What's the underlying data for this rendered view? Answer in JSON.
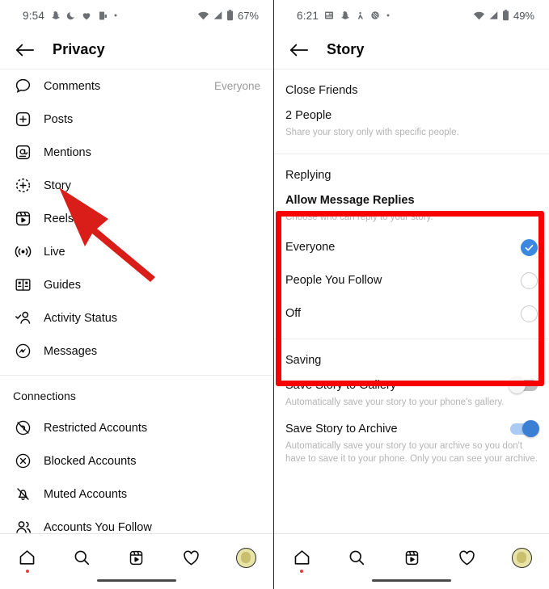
{
  "left": {
    "statusbar": {
      "time": "9:54",
      "icons": [
        "snapchat-icon",
        "moon-icon",
        "heart-icon",
        "phone-link-icon",
        "dot-icon"
      ],
      "wifi": "wifi-icon",
      "signal": "signal-icon",
      "battery_icon": "battery-icon",
      "battery": "67%"
    },
    "appbar": {
      "back": "back-arrow-icon",
      "title": "Privacy"
    },
    "items": [
      {
        "icon": "comment-bubble-icon",
        "label": "Comments",
        "value": "Everyone"
      },
      {
        "icon": "plus-square-icon",
        "label": "Posts",
        "value": ""
      },
      {
        "icon": "at-sign-icon",
        "label": "Mentions",
        "value": ""
      },
      {
        "icon": "story-plus-icon",
        "label": "Story",
        "value": ""
      },
      {
        "icon": "reels-icon",
        "label": "Reels",
        "value": ""
      },
      {
        "icon": "live-icon",
        "label": "Live",
        "value": ""
      },
      {
        "icon": "guides-icon",
        "label": "Guides",
        "value": ""
      },
      {
        "icon": "activity-status-icon",
        "label": "Activity Status",
        "value": ""
      },
      {
        "icon": "messenger-icon",
        "label": "Messages",
        "value": ""
      }
    ],
    "connections_header": "Connections",
    "connections": [
      {
        "icon": "restricted-account-icon",
        "label": "Restricted Accounts"
      },
      {
        "icon": "blocked-account-icon",
        "label": "Blocked Accounts"
      },
      {
        "icon": "muted-account-icon",
        "label": "Muted Accounts"
      },
      {
        "icon": "people-icon",
        "label": "Accounts You Follow"
      }
    ]
  },
  "right": {
    "statusbar": {
      "time": "6:21",
      "icons": [
        "news-icon",
        "snapchat-icon",
        "person-icon",
        "sports-icon",
        "dot-icon"
      ],
      "wifi": "wifi-icon",
      "signal": "signal-icon",
      "battery_icon": "battery-icon",
      "battery": "49%"
    },
    "appbar": {
      "back": "back-arrow-icon",
      "title": "Story"
    },
    "close_friends": {
      "header": "Close Friends",
      "value": "2 People",
      "sub": "Share your story only with specific people."
    },
    "replying": {
      "header": "Replying",
      "title": "Allow Message Replies",
      "sub": "Choose who can reply to your story.",
      "options": [
        {
          "label": "Everyone",
          "selected": true
        },
        {
          "label": "People You Follow",
          "selected": false
        },
        {
          "label": "Off",
          "selected": false
        }
      ]
    },
    "saving": {
      "header": "Saving",
      "rows": [
        {
          "title": "Save Story to Gallery",
          "sub": "Automatically save your story to your phone's gallery.",
          "on": false
        },
        {
          "title": "Save Story to Archive",
          "sub": "Automatically save your story to your archive so you don't have to save it to your phone. Only you can see your archive.",
          "on": true
        }
      ]
    }
  },
  "bottomnav": {
    "items": [
      "home-icon",
      "search-icon",
      "reels-icon",
      "heart-icon",
      "profile-avatar"
    ]
  },
  "annotations": {
    "highlight_color": "#f60000",
    "arrow_color": "#d91d18",
    "arrow_target": "story-menu-item"
  }
}
